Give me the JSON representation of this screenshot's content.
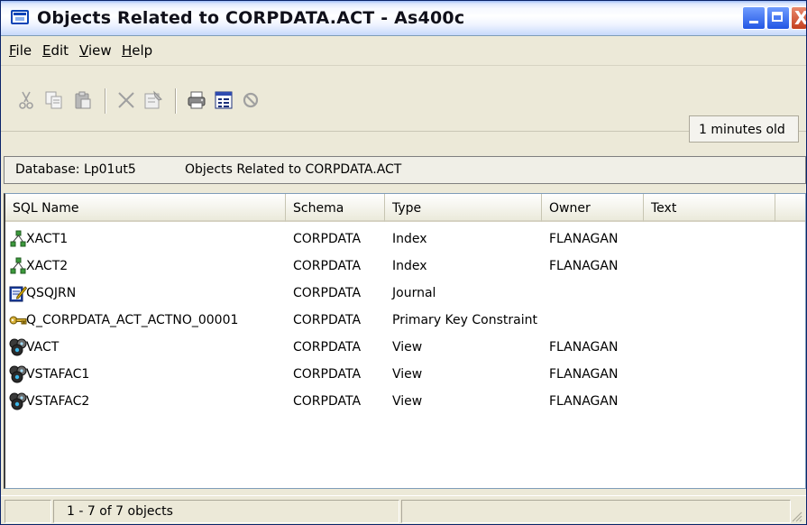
{
  "window": {
    "title": "Objects Related to CORPDATA.ACT - As400c",
    "controls": {
      "close_glyph": "X"
    }
  },
  "menu": {
    "items": [
      {
        "label": "File",
        "ul": "F",
        "rest": "ile"
      },
      {
        "label": "Edit",
        "ul": "E",
        "rest": "dit"
      },
      {
        "label": "View",
        "ul": "V",
        "rest": "iew"
      },
      {
        "label": "Help",
        "ul": "H",
        "rest": "elp"
      }
    ]
  },
  "toolbar": {
    "icons": [
      "cut-icon",
      "copy-icon",
      "paste-icon",
      "delete-icon",
      "properties-icon",
      "print-icon",
      "details-icon",
      "stop-icon"
    ],
    "age": "1 minutes old"
  },
  "infobar": {
    "database": "Database: Lp01ut5",
    "object": "Objects Related to CORPDATA.ACT"
  },
  "list": {
    "columns": [
      "SQL Name",
      "Schema",
      "Type",
      "Owner",
      "Text"
    ],
    "rows": [
      {
        "icon": "index-icon",
        "name": "XACT1",
        "schema": "CORPDATA",
        "type": "Index",
        "owner": "FLANAGAN",
        "text": ""
      },
      {
        "icon": "index-icon",
        "name": "XACT2",
        "schema": "CORPDATA",
        "type": "Index",
        "owner": "FLANAGAN",
        "text": ""
      },
      {
        "icon": "journal-icon",
        "name": "QSQJRN",
        "schema": "CORPDATA",
        "type": "Journal",
        "owner": "",
        "text": ""
      },
      {
        "icon": "key-icon",
        "name": "Q_CORPDATA_ACT_ACTNO_00001",
        "schema": "CORPDATA",
        "type": "Primary Key Constraint",
        "owner": "",
        "text": ""
      },
      {
        "icon": "view-icon",
        "name": "VACT",
        "schema": "CORPDATA",
        "type": "View",
        "owner": "FLANAGAN",
        "text": ""
      },
      {
        "icon": "view-icon",
        "name": "VSTAFAC1",
        "schema": "CORPDATA",
        "type": "View",
        "owner": "FLANAGAN",
        "text": ""
      },
      {
        "icon": "view-icon",
        "name": "VSTAFAC2",
        "schema": "CORPDATA",
        "type": "View",
        "owner": "FLANAGAN",
        "text": ""
      }
    ]
  },
  "status": {
    "count": "1 - 7 of 7 objects"
  }
}
